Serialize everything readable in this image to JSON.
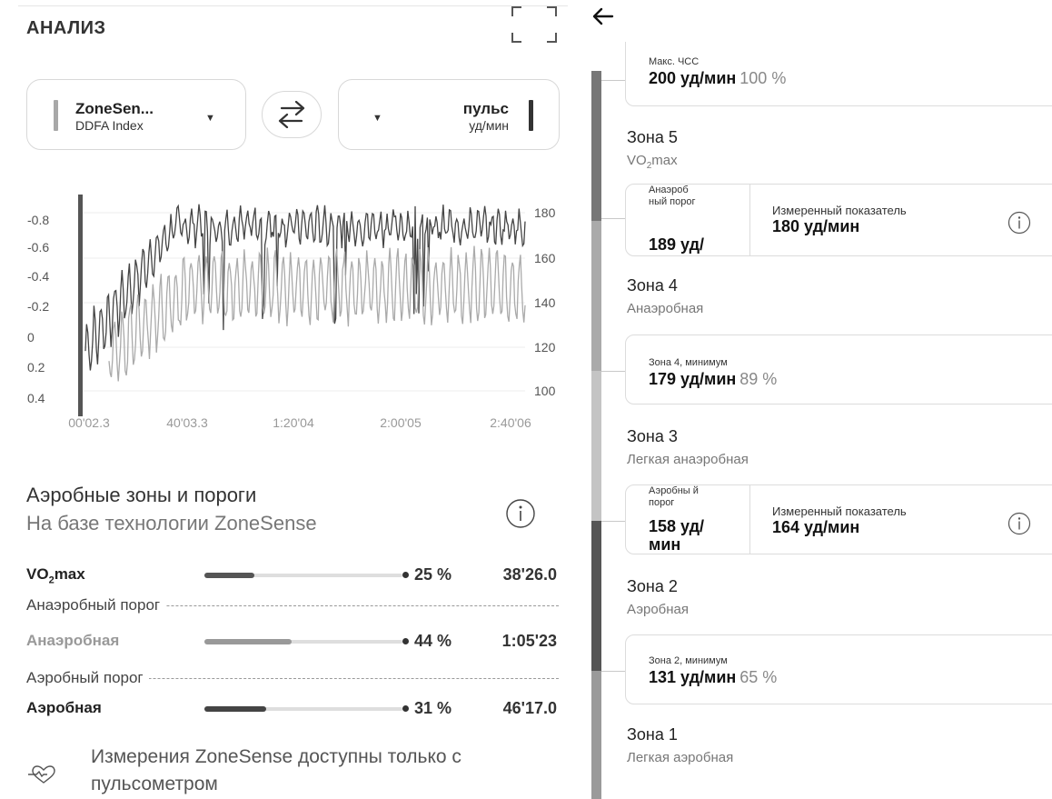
{
  "header": {
    "title": "АНАЛИЗ",
    "expand_icon": "expand-icon"
  },
  "selectors": {
    "left": {
      "name": "ZoneSen...",
      "sub": "DDFA Index",
      "color": "#a8a8a8"
    },
    "right": {
      "name": "пульс",
      "sub": "уд/мин",
      "color": "#333333"
    },
    "swap_icon": "swap-arrows-icon"
  },
  "chart_data": {
    "type": "line",
    "x_tick_labels": [
      "00'02.3",
      "40'03.3",
      "1:20'04",
      "2:00'05",
      "2:40'06"
    ],
    "y_left_tick_labels": [
      "-0.8",
      "-0.6",
      "-0.4",
      "-0.2",
      "0",
      "0.2",
      "0.4"
    ],
    "y_left_range": [
      0.4,
      -0.8
    ],
    "y_right_tick_labels": [
      "180",
      "160",
      "140",
      "120",
      "100"
    ],
    "y_right_range": [
      95,
      185
    ],
    "grid": true,
    "series": [
      {
        "name": "пульс",
        "axis": "right",
        "color": "#444444"
      },
      {
        "name": "DDFA Index",
        "axis": "left",
        "color": "#aaaaaa"
      }
    ]
  },
  "zones_section": {
    "title": "Аэробные зоны и пороги",
    "subtitle": "На базе технологии ZoneSense",
    "info_icon": "info-icon",
    "rows": [
      {
        "name": "VO",
        "sub": "2",
        "name_tail": "max",
        "percent": 25,
        "percent_label": "25 %",
        "time": "38'26.0",
        "color": "#555555"
      },
      {
        "name": "Анаэробная",
        "percent": 44,
        "percent_label": "44 %",
        "time": "1:05'23",
        "color": "#999999"
      },
      {
        "name": "Аэробная",
        "percent": 31,
        "percent_label": "31 %",
        "time": "46'17.0",
        "color": "#444444"
      }
    ],
    "thresholds": [
      "Анаэробный порог",
      "Аэробный порог"
    ],
    "note": "Измерения ZoneSense доступны только с пульсометром",
    "note_icon": "heart-pulse-icon"
  },
  "right_panel": {
    "back_icon": "back-arrow-icon",
    "max_hr": {
      "label": "Макс. ЧСС",
      "value": "200 уд/мин",
      "percent": "100 %"
    },
    "zone5": {
      "title": "Зона 5",
      "sub_a": "VO",
      "sub_b": "2",
      "sub_c": "max"
    },
    "anaerobic_threshold": {
      "label": "Анаэроб ный порог",
      "value": "189 уд/",
      "measured_label": "Измеренный показатель",
      "measured_value": "180 уд/мин"
    },
    "zone4": {
      "title": "Зона 4",
      "sub": "Анаэробная"
    },
    "zone4_min": {
      "label": "Зона 4, минимум",
      "value": "179 уд/мин",
      "percent": "89 %"
    },
    "zone3": {
      "title": "Зона 3",
      "sub": "Легкая анаэробная"
    },
    "aerobic_threshold": {
      "label": "Аэробны й порог",
      "value": "158 уд/ мин",
      "measured_label": "Измеренный показатель",
      "measured_value": "164 уд/мин"
    },
    "zone2": {
      "title": "Зона 2",
      "sub": "Аэробная"
    },
    "zone2_min": {
      "label": "Зона 2, минимум",
      "value": "131 уд/мин",
      "percent": "65 %"
    },
    "zone1": {
      "title": "Зона 1",
      "sub": "Легкая аэробная"
    },
    "scale_colors": [
      "#777777",
      "#aaaaaa",
      "#c4c4c4",
      "#555555",
      "#9a9a9a"
    ]
  }
}
